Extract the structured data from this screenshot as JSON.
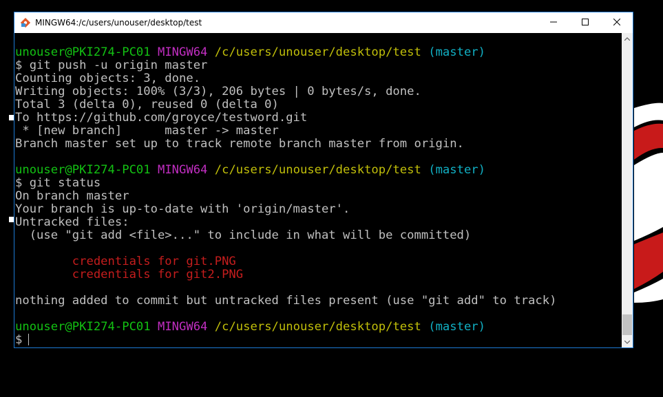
{
  "window": {
    "title": "MINGW64:/c/users/unouser/desktop/test",
    "icon": "git-bash-icon",
    "buttons": [
      "minimize-icon",
      "maximize-icon",
      "close-icon"
    ]
  },
  "colors": {
    "user": "#13c213",
    "system": "#c12ec1",
    "path": "#c1bf0a",
    "branch": "#11b0c4",
    "untracked": "#c51d1d",
    "text": "#c0c0c0"
  },
  "terminal": {
    "prompt_user": "unouser@PKI274-PC01",
    "prompt_system": "MINGW64",
    "prompt_path": "/c/users/unouser/desktop/test",
    "prompt_branch": "(master)",
    "blocks": {
      "push_cmd": "$ git push -u origin master",
      "push_out1": "Counting objects: 3, done.",
      "push_out2": "Writing objects: 100% (3/3), 206 bytes | 0 bytes/s, done.",
      "push_out3": "Total 3 (delta 0), reused 0 (delta 0)",
      "push_out4": "To https://github.com/groyce/testword.git",
      "push_out5": " * [new branch]      master -> master",
      "push_out6": "Branch master set up to track remote branch master from origin.",
      "status_cmd": "$ git status",
      "status_out1": "On branch master",
      "status_out2": "Your branch is up-to-date with 'origin/master'.",
      "status_out3": "Untracked files:",
      "status_out4": "  (use \"git add <file>...\" to include in what will be committed)",
      "untracked1": "        credentials for git.PNG",
      "untracked2": "        credentials for git2.PNG",
      "status_out5": "nothing added to commit but untracked files present (use \"git add\" to track)",
      "final_prompt": "$"
    }
  }
}
